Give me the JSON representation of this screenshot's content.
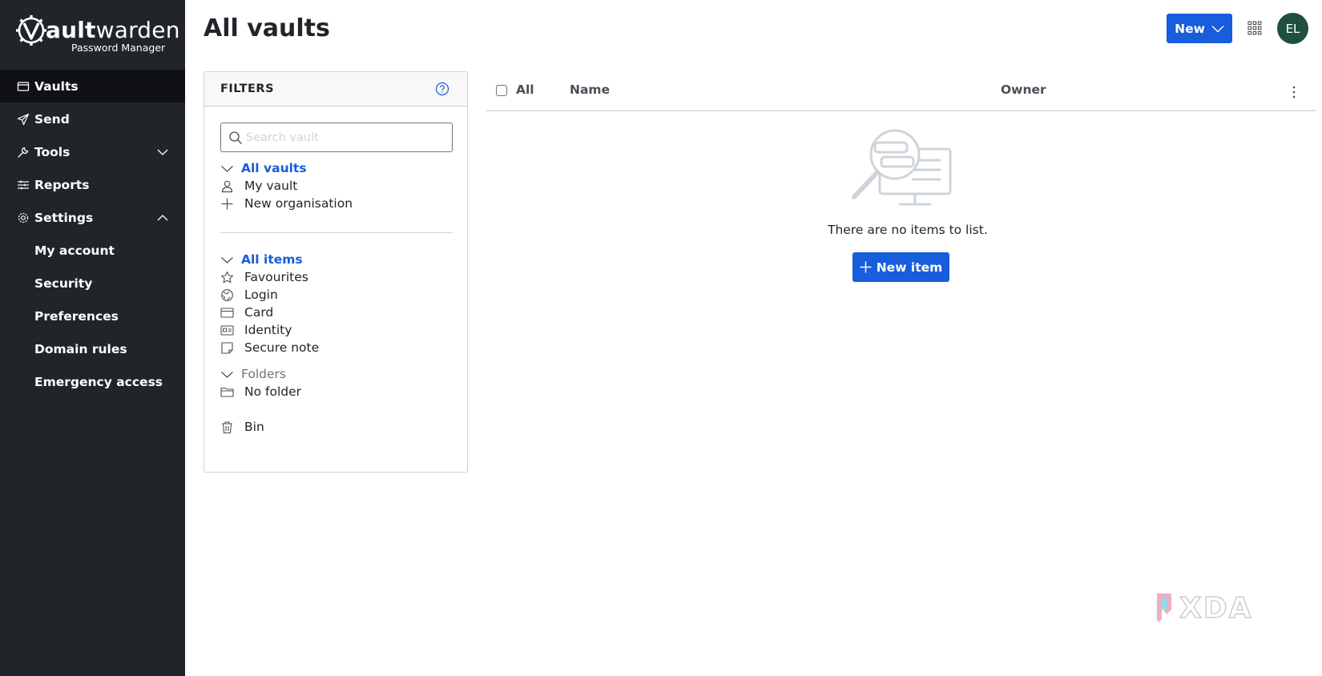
{
  "brand": {
    "name_bold": "ault",
    "name_light": "warden",
    "subtitle": "Password Manager"
  },
  "sidebar": {
    "items": [
      {
        "label": "Vaults",
        "icon": "vault-icon",
        "active": true
      },
      {
        "label": "Send",
        "icon": "send-icon"
      },
      {
        "label": "Tools",
        "icon": "wrench-icon",
        "expandable": true
      },
      {
        "label": "Reports",
        "icon": "sliders-icon"
      },
      {
        "label": "Settings",
        "icon": "gear-icon",
        "expanded": true
      }
    ],
    "settings_children": [
      "My account",
      "Security",
      "Preferences",
      "Domain rules",
      "Emergency access"
    ]
  },
  "header": {
    "title": "All vaults",
    "new_label": "New",
    "avatar_initials": "EL"
  },
  "filters": {
    "title": "FILTERS",
    "search_placeholder": "Search vault",
    "vaults_group": "All vaults",
    "vaults": [
      "My vault",
      "New organisation"
    ],
    "items_group": "All items",
    "items": [
      "Favourites",
      "Login",
      "Card",
      "Identity",
      "Secure note"
    ],
    "folders_group": "Folders",
    "folders": [
      "No folder"
    ],
    "bin": "Bin"
  },
  "table": {
    "col_all": "All",
    "col_name": "Name",
    "col_owner": "Owner",
    "empty_message": "There are no items to list.",
    "new_item_label": "New item"
  },
  "watermark": "XDA",
  "colors": {
    "sidebar_bg": "#212529",
    "primary": "#175ddc",
    "avatar_bg": "#1f4f3f"
  }
}
